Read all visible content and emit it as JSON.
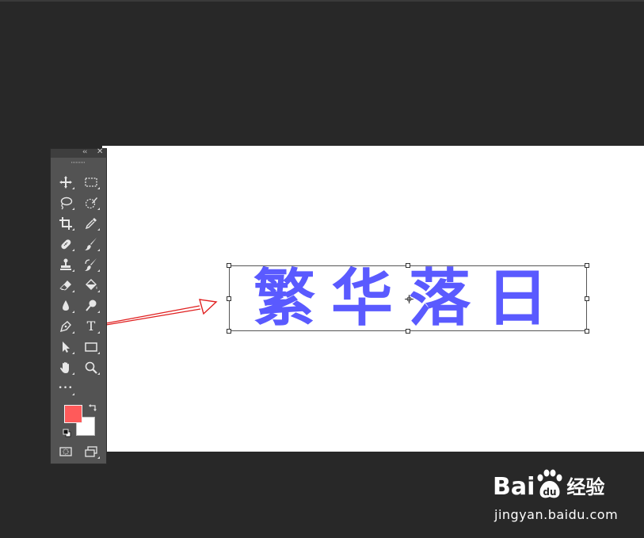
{
  "canvas": {
    "text_layer": {
      "text": "繁华落日",
      "color": "#5a5aff"
    }
  },
  "toolbar": {
    "header": {
      "collapse_glyph": "‹‹",
      "close_glyph": "✕"
    },
    "tools": [
      {
        "name": "move-tool",
        "icon": "move-icon"
      },
      {
        "name": "marquee-tool",
        "icon": "rect-marquee-icon"
      },
      {
        "name": "lasso-tool",
        "icon": "lasso-icon"
      },
      {
        "name": "quick-selection-tool",
        "icon": "quick-selection-icon"
      },
      {
        "name": "crop-tool",
        "icon": "crop-icon"
      },
      {
        "name": "eyedropper-tool",
        "icon": "eyedropper-icon"
      },
      {
        "name": "healing-brush-tool",
        "icon": "bandage-icon"
      },
      {
        "name": "brush-tool",
        "icon": "brush-icon"
      },
      {
        "name": "clone-stamp-tool",
        "icon": "stamp-icon"
      },
      {
        "name": "history-brush-tool",
        "icon": "history-brush-icon"
      },
      {
        "name": "eraser-tool",
        "icon": "eraser-icon"
      },
      {
        "name": "paint-bucket-tool",
        "icon": "bucket-icon"
      },
      {
        "name": "blur-tool",
        "icon": "drop-icon"
      },
      {
        "name": "dodge-tool",
        "icon": "dodge-icon"
      },
      {
        "name": "pen-tool",
        "icon": "pen-icon"
      },
      {
        "name": "type-tool",
        "icon": "type-icon",
        "glyph": "T"
      },
      {
        "name": "path-selection-tool",
        "icon": "arrow-icon"
      },
      {
        "name": "rectangle-tool",
        "icon": "rectangle-icon"
      },
      {
        "name": "hand-tool",
        "icon": "hand-icon"
      },
      {
        "name": "zoom-tool",
        "icon": "zoom-icon"
      },
      {
        "name": "more-tools",
        "icon": "ellipsis-icon",
        "glyph": "•••"
      }
    ],
    "foreground_color": "#ff5a5a",
    "background_color": "#ffffff"
  },
  "annotation": {
    "arrow_color": "#e02020"
  },
  "watermark": {
    "brand_prefix": "Bai",
    "brand_suffix": "经验",
    "domain": "jingyan.baidu.com"
  }
}
